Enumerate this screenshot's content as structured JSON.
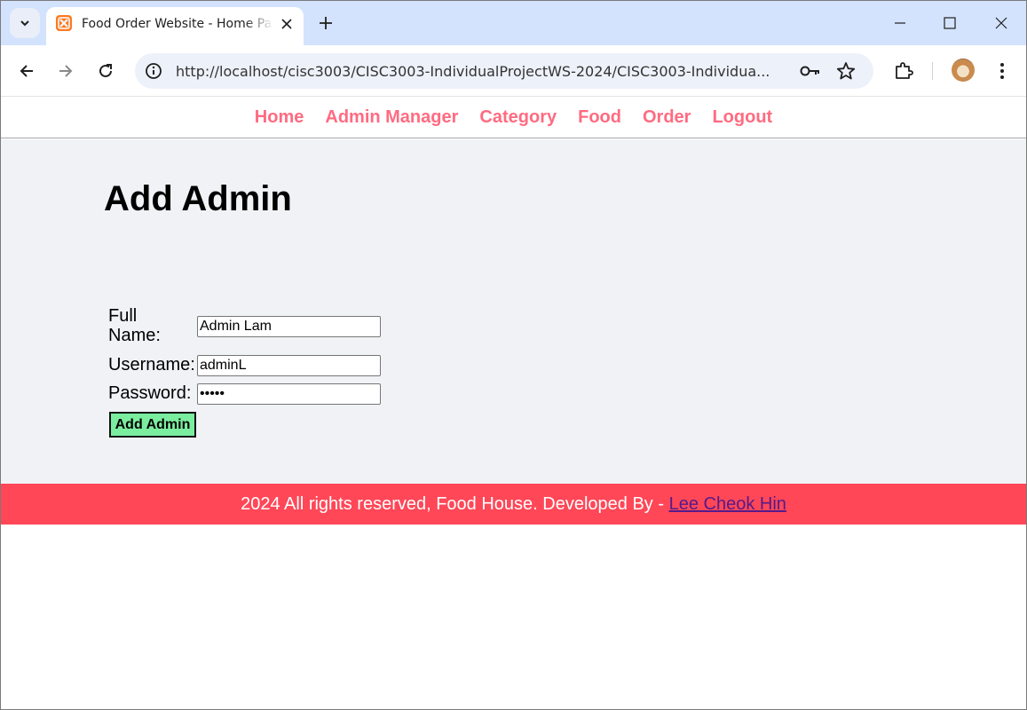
{
  "browser": {
    "tab": {
      "title": "Food Order Website - Home Page"
    },
    "address": {
      "url": "http://localhost/cisc3003/CISC3003-IndividualProjectWS-2024/CISC3003-Individua..."
    }
  },
  "site": {
    "nav": [
      "Home",
      "Admin Manager",
      "Category",
      "Food",
      "Order",
      "Logout"
    ],
    "heading": "Add Admin",
    "form": {
      "full_name_label": "Full Name:",
      "full_name_value": "Admin Lam",
      "username_label": "Username:",
      "username_value": "adminL",
      "password_label": "Password:",
      "password_value": "•••••",
      "submit_label": "Add Admin"
    },
    "footer": {
      "text": "2024 All rights reserved, Food House. Developed By - ",
      "link": "Lee Cheok Hin"
    },
    "colors": {
      "nav_link": "#ff6b81",
      "main_bg": "#f1f2f6",
      "footer_bg": "#ff4757",
      "submit_bg": "#7bed9f"
    }
  }
}
